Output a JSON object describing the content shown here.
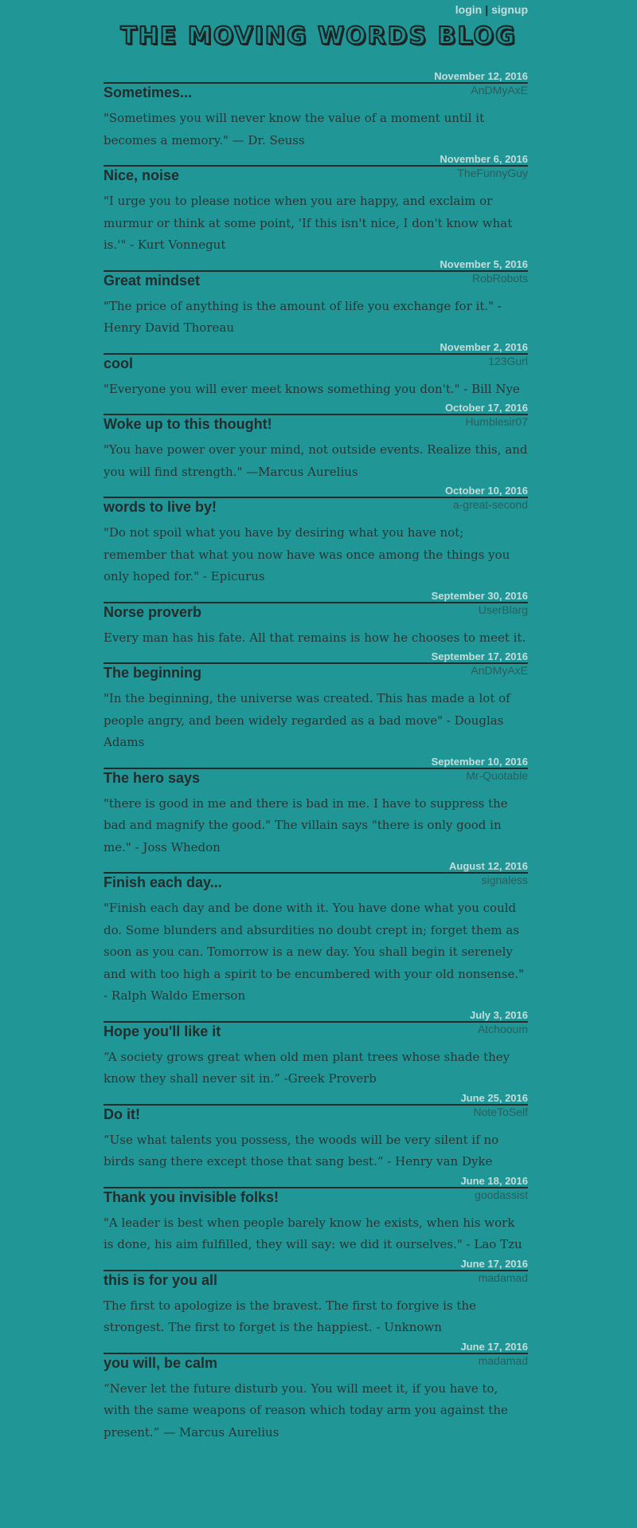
{
  "nav": {
    "login": "login",
    "separator": "|",
    "signup": "signup"
  },
  "site_title": "THE MOVING WORDS BLOG",
  "posts": [
    {
      "date": "November 12, 2016",
      "title": "Sometimes...",
      "author": "AnDMyAxE",
      "body": "\"Sometimes you will never know the value of a moment until it becomes a memory.\" — Dr. Seuss"
    },
    {
      "date": "November 6, 2016",
      "title": "Nice, noise",
      "author": "TheFunnyGuy",
      "body": "\"I urge you to please notice when you are happy, and exclaim or murmur or think at some point, 'If this isn't nice, I don't know what is.'\" - Kurt Vonnegut"
    },
    {
      "date": "November 5, 2016",
      "title": "Great mindset",
      "author": "RobRobots",
      "body": "\"The price of anything is the amount of life you exchange for it.\" - Henry David Thoreau"
    },
    {
      "date": "November 2, 2016",
      "title": "cool",
      "author": "123Gurl",
      "body": "\"Everyone you will ever meet knows something you don't.\" - Bill Nye"
    },
    {
      "date": "October 17, 2016",
      "title": "Woke up to this thought!",
      "author": "Humblesir07",
      "body": "\"You have power over your mind, not outside events. Realize this, and you will find strength.\" —Marcus Aurelius"
    },
    {
      "date": "October 10, 2016",
      "title": "words to live by!",
      "author": "a-great-second",
      "body": "\"Do not spoil what you have by desiring what you have not; remember that what you now have was once among the things you only hoped for.\" - Epicurus"
    },
    {
      "date": "September 30, 2016",
      "title": "Norse proverb",
      "author": "UserBlarg",
      "body": "Every man has his fate. All that remains is how he chooses to meet it."
    },
    {
      "date": "September 17, 2016",
      "title": "The beginning",
      "author": "AnDMyAxE",
      "body": "\"In the beginning, the universe was created. This has made a lot of people angry, and been widely regarded as a bad move\" - Douglas Adams"
    },
    {
      "date": "September 10, 2016",
      "title": "The hero says",
      "author": "Mr-Quotable",
      "body": "\"there is good in me and there is bad in me. I have to suppress the bad and magnify the good.\" The villain says \"there is only good in me.\" - Joss Whedon"
    },
    {
      "date": "August 12, 2016",
      "title": "Finish each day...",
      "author": "signaless",
      "body": "\"Finish each day and be done with it. You have done what you could do. Some blunders and absurdities no doubt crept in; forget them as soon as you can. Tomorrow is a new day. You shall begin it serenely and with too high a spirit to be encumbered with your old nonsense.\" - Ralph Waldo Emerson"
    },
    {
      "date": "July 3, 2016",
      "title": "Hope you'll like it",
      "author": "Atchooum",
      "body": "“A society grows great when old men plant trees whose shade they know they shall never sit in.” -Greek Proverb"
    },
    {
      "date": "June 25, 2016",
      "title": "Do it!",
      "author": "NoteToSelf",
      "body": "“Use what talents you possess, the woods will be very silent if no birds sang there except those that sang best.” - Henry van Dyke"
    },
    {
      "date": "June 18, 2016",
      "title": "Thank you invisible folks!",
      "author": "goodassist",
      "body": "\"A leader is best when people barely know he exists, when his work is done, his aim fulfilled, they will say: we did it ourselves.\" - Lao Tzu"
    },
    {
      "date": "June 17, 2016",
      "title": "this is for you all",
      "author": "madamad",
      "body": "The first to apologize is the bravest. The first to forgive is the strongest. The first to forget is the happiest. - Unknown"
    },
    {
      "date": "June 17, 2016",
      "title": "you will, be calm",
      "author": "madamad",
      "body": "“Never let the future disturb you. You will meet it, if you have to, with the same weapons of reason which today arm you against the present.” — Marcus Aurelius"
    }
  ]
}
